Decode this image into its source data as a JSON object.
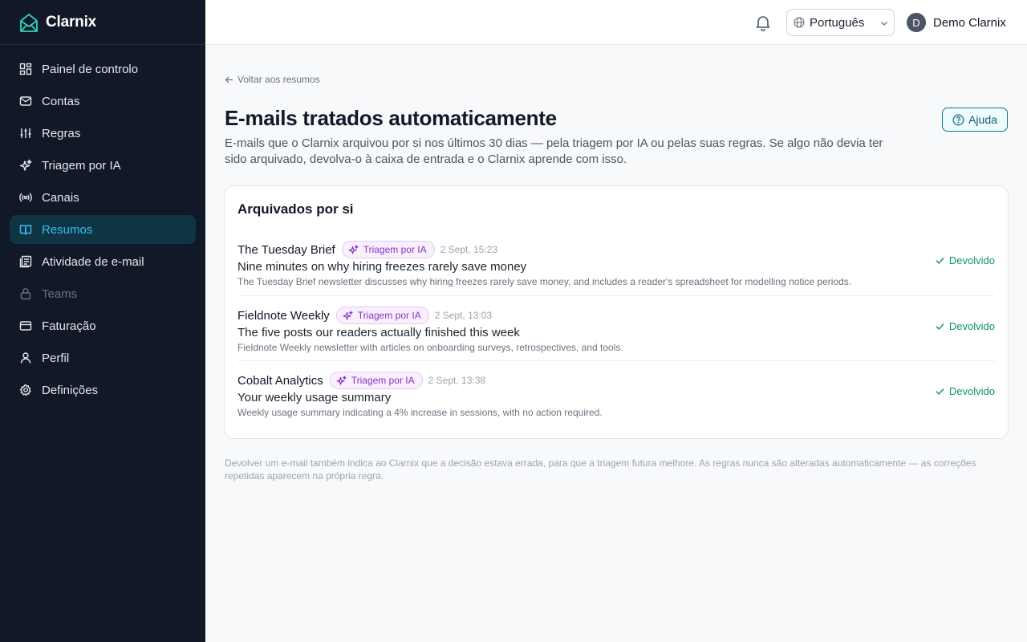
{
  "app": {
    "name": "Clarnix"
  },
  "sidebar": {
    "items": [
      {
        "label": "Painel de controlo",
        "icon": "dashboard-icon"
      },
      {
        "label": "Contas",
        "icon": "mail-icon"
      },
      {
        "label": "Regras",
        "icon": "sliders-icon"
      },
      {
        "label": "Triagem por IA",
        "icon": "sparkles-icon"
      },
      {
        "label": "Canais",
        "icon": "radio-icon"
      },
      {
        "label": "Resumos",
        "icon": "book-open-icon",
        "active": true
      },
      {
        "label": "Atividade de e-mail",
        "icon": "activity-log-icon"
      },
      {
        "label": "Teams",
        "icon": "lock-icon",
        "disabled": true
      },
      {
        "label": "Faturação",
        "icon": "credit-card-icon"
      },
      {
        "label": "Perfil",
        "icon": "user-icon"
      },
      {
        "label": "Definições",
        "icon": "gear-icon"
      }
    ]
  },
  "topbar": {
    "language": "Português",
    "user": {
      "initial": "D",
      "name": "Demo Clarnix"
    }
  },
  "page": {
    "back_link": "Voltar aos resumos",
    "title": "E-mails tratados automaticamente",
    "description": "E-mails que o Clarnix arquivou por si nos últimos 30 dias — pela triagem por IA ou pelas suas regras. Se algo não devia ter sido arquivado, devolva-o à caixa de entrada e o Clarnix aprende com isso.",
    "help_label": "Ajuda",
    "card_title": "Arquivados por si",
    "emails": [
      {
        "sender": "The Tuesday Brief",
        "badge": "Triagem por IA",
        "date": "2 Sept, 15:23",
        "subject": "Nine minutes on why hiring freezes rarely save money",
        "summary": "The Tuesday Brief newsletter discusses why hiring freezes rarely save money, and includes a reader's spreadsheet for modelling notice periods.",
        "status": "Devolvido"
      },
      {
        "sender": "Fieldnote Weekly",
        "badge": "Triagem por IA",
        "date": "2 Sept, 13:03",
        "subject": "The five posts our readers actually finished this week",
        "summary": "Fieldnote Weekly newsletter with articles on onboarding surveys, retrospectives, and tools.",
        "status": "Devolvido"
      },
      {
        "sender": "Cobalt Analytics",
        "badge": "Triagem por IA",
        "date": "2 Sept, 13:38",
        "subject": "Your weekly usage summary",
        "summary": "Weekly usage summary indicating a 4% increase in sessions, with no action required.",
        "status": "Devolvido"
      }
    ],
    "footnote": "Devolver um e-mail também indica ao Clarnix que a decisão estava errada, para que a triagem futura melhore. As regras nunca são alteradas automaticamente — as correções repetidas aparecem na própria regra."
  },
  "colors": {
    "sidebar_bg": "#111827",
    "active_accent": "#38bdf8",
    "ai_badge": "#8b2fc9",
    "returned_status": "#10916b"
  }
}
